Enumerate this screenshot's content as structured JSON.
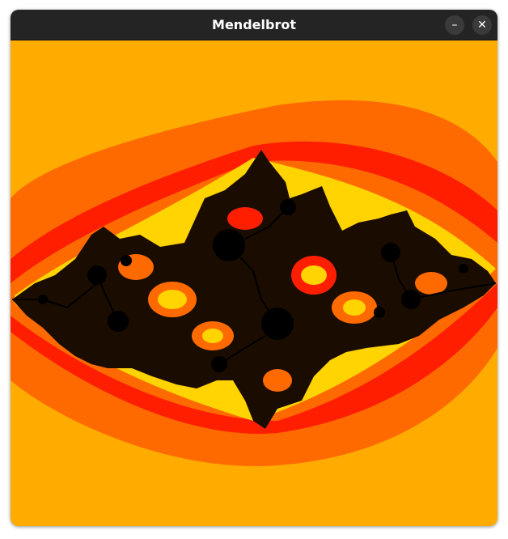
{
  "window": {
    "title": "Mendelbrot",
    "minimize_glyph": "–",
    "close_glyph": "✕"
  },
  "canvas": {
    "description_free": "",
    "colors": {
      "background": "#ffab00",
      "band_orange": "#ff6a00",
      "band_red": "#ff1f00",
      "band_yellow": "#ffd400",
      "set_black": "#000000"
    }
  }
}
